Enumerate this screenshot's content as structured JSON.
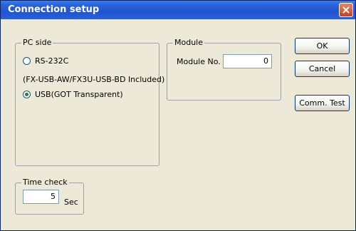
{
  "window": {
    "title": "Connection setup"
  },
  "pc_side": {
    "legend": "PC side",
    "options": [
      {
        "label": "RS-232C",
        "selected": false
      },
      {
        "label": "USB(GOT Transparent)",
        "selected": true
      }
    ],
    "note": "(FX-USB-AW/FX3U-USB-BD Included)"
  },
  "module": {
    "legend": "Module",
    "module_no_label": "Module No.",
    "module_no_value": "0"
  },
  "time_check": {
    "legend": "Time check",
    "value": "5",
    "unit": "Sec"
  },
  "buttons": {
    "ok": "OK",
    "cancel": "Cancel",
    "comm_test": "Comm. Test"
  },
  "colors": {
    "titlebar": "#2a64dc",
    "dialog_bg": "#ece9d8",
    "close_button": "#c4401e"
  }
}
